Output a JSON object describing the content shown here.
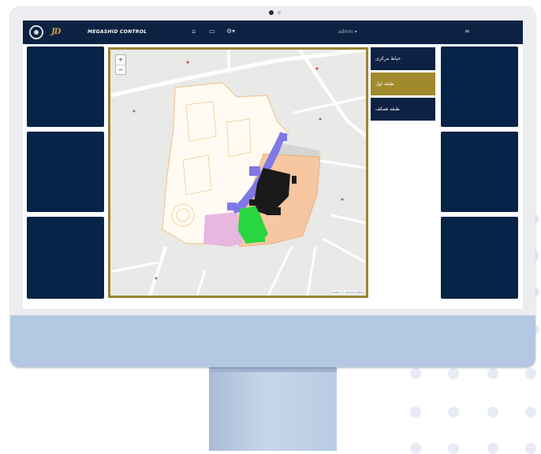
{
  "navbar": {
    "brand_mark": "JD",
    "brand_text": "MEGASHID CONTROL",
    "home_icon": "home-icon",
    "monitor_icon": "monitor-icon",
    "settings_icon": "settings-icon",
    "user_label": "admin ▾",
    "menu_icon": "hamburger-icon"
  },
  "map": {
    "zoom_in": "+",
    "zoom_out": "−",
    "attribution": "Leaflet | © OpenStreetMap"
  },
  "side_menu": {
    "items": [
      {
        "label": "حیاط مرکزی",
        "active": false
      },
      {
        "label": "طبقه اول",
        "active": true
      },
      {
        "label": "طبقه همکف",
        "active": false
      }
    ]
  },
  "colors": {
    "navy": "#0d2242",
    "tile": "#062348",
    "gold": "#a08a2c",
    "monitor_chin": "#b4c8e3"
  }
}
